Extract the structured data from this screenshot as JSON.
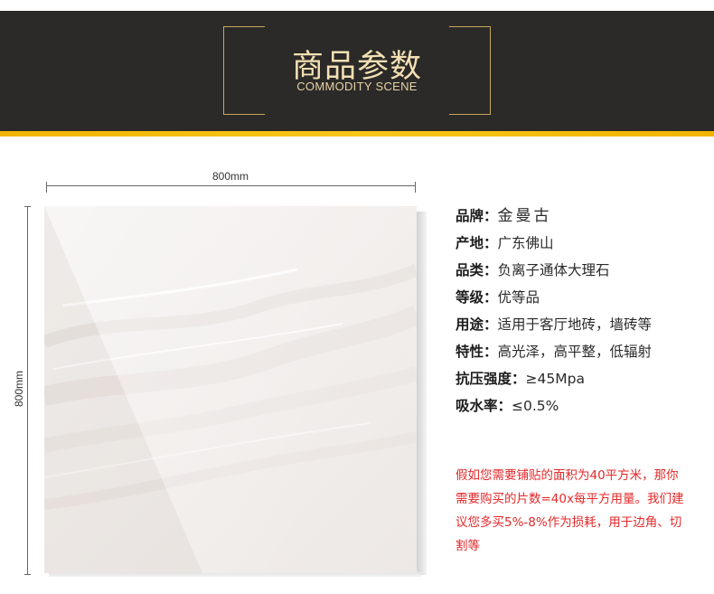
{
  "header": {
    "title_cn": "商品参数",
    "title_en": "COMMODITY SCENE",
    "background": "#2b2a28",
    "accent": "#f2b400",
    "bracket_color": "#c8a85a"
  },
  "dimensions": {
    "width_label": "800mm",
    "height_label": "800mm"
  },
  "specs": [
    {
      "label": "品牌：",
      "value": "金曼古"
    },
    {
      "label": "产地：",
      "value": "广东佛山"
    },
    {
      "label": "品类：",
      "value": "负离子通体大理石"
    },
    {
      "label": "等级：",
      "value": "优等品"
    },
    {
      "label": "用途：",
      "value": "适用于客厅地砖，墙砖等"
    },
    {
      "label": "特性：",
      "value": "高光泽，高平整，低辐射"
    },
    {
      "label": "抗压强度：",
      "value": "≥45Mpa"
    },
    {
      "label": "吸水率：",
      "value": "≤0.5%"
    }
  ],
  "note": {
    "text": "假如您需要铺贴的面积为40平方米，那你需要购买的片数=40x每平方用量。我们建议您多买5%-8%作为损耗，用于边角、切割等",
    "color": "#e4282a"
  }
}
